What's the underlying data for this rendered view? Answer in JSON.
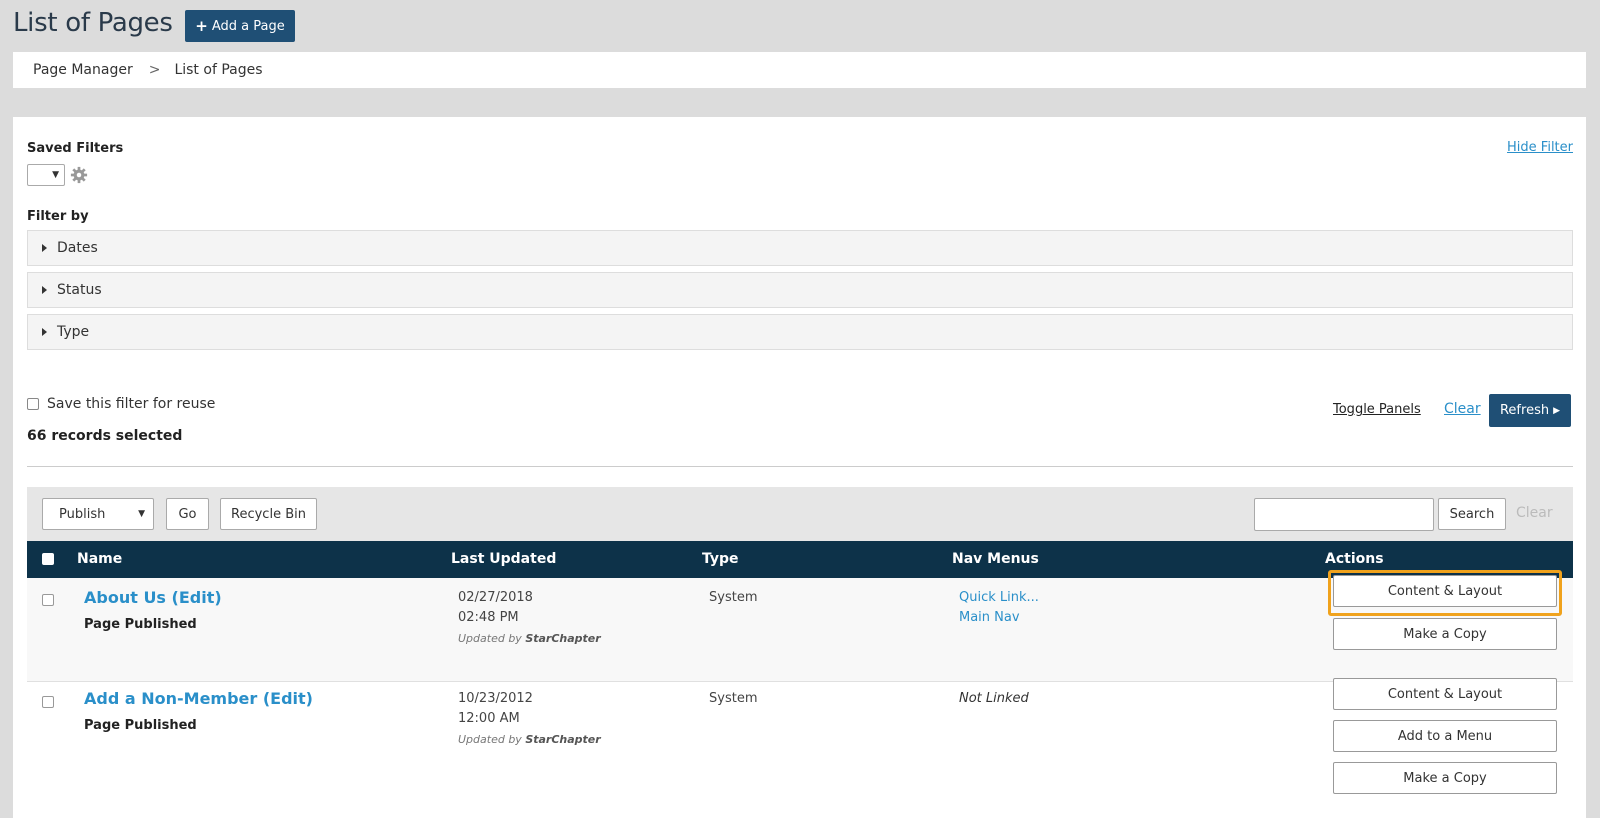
{
  "header": {
    "title": "List of Pages",
    "add_page_icon": "+",
    "add_page_label": "Add a Page"
  },
  "breadcrumb": {
    "items": [
      "Page Manager",
      "List of Pages"
    ],
    "separator": ">"
  },
  "filters": {
    "saved_filters_label": "Saved Filters",
    "saved_select_caret": "▼",
    "gear_icon": "gear-icon",
    "hide_filter_label": "Hide Filter",
    "filter_by_label": "Filter by",
    "panels": [
      "Dates",
      "Status",
      "Type"
    ],
    "save_filter_label": "Save this filter for reuse",
    "records_selected": "66 records selected",
    "toggle_panels_label": "Toggle Panels",
    "clear_label": "Clear",
    "refresh_label": "Refresh",
    "refresh_caret": "▶"
  },
  "toolbar": {
    "bulk_action_value": "Publish",
    "bulk_caret": "▼",
    "go_label": "Go",
    "recycle_label": "Recycle Bin",
    "search_value": "",
    "search_label": "Search",
    "clear_label": "Clear"
  },
  "table": {
    "columns": [
      "Name",
      "Last Updated",
      "Type",
      "Nav Menus",
      "Actions"
    ],
    "rows": [
      {
        "name": "About Us (Edit)",
        "status": "Page Published",
        "date": "02/27/2018",
        "time": "02:48 PM",
        "updated_by_prefix": "Updated by",
        "updated_by": "StarChapter",
        "type": "System",
        "nav_menus": [
          "Quick Link...",
          "Main Nav"
        ],
        "actions": [
          "Content & Layout",
          "Make a Copy"
        ]
      },
      {
        "name": "Add a Non-Member (Edit)",
        "status": "Page Published",
        "date": "10/23/2012",
        "time": "12:00 AM",
        "updated_by_prefix": "Updated by",
        "updated_by": "StarChapter",
        "type": "System",
        "nav_menus_text": "Not Linked",
        "actions": [
          "Content & Layout",
          "Add to a Menu",
          "Make a Copy"
        ]
      }
    ]
  },
  "colors": {
    "primary": "#1f4f75",
    "table_header": "#0d3249",
    "link": "#2a8fc9",
    "highlight": "#f0a21c",
    "background": "#dcdcdc"
  }
}
